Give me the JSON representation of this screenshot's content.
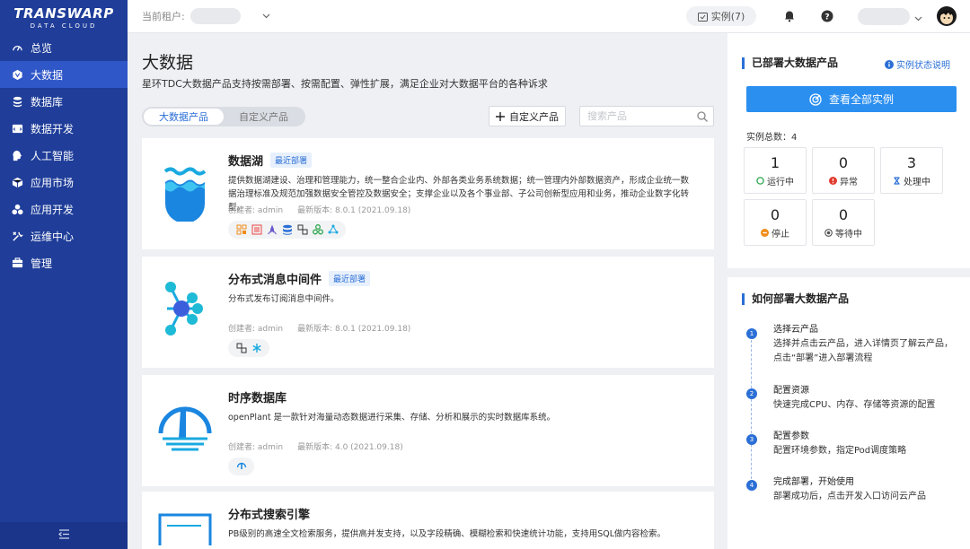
{
  "brand": {
    "line1": "TRANSWARP",
    "line2": "DATA CLOUD"
  },
  "sidebar": {
    "items": [
      {
        "label": "总览",
        "icon": "dashboard-icon"
      },
      {
        "label": "大数据",
        "icon": "bigdata-icon"
      },
      {
        "label": "数据库",
        "icon": "database-icon"
      },
      {
        "label": "数据开发",
        "icon": "dev-icon"
      },
      {
        "label": "人工智能",
        "icon": "ai-icon"
      },
      {
        "label": "应用市场",
        "icon": "market-icon"
      },
      {
        "label": "应用开发",
        "icon": "appdev-icon"
      },
      {
        "label": "运维中心",
        "icon": "ops-icon"
      },
      {
        "label": "管理",
        "icon": "admin-icon"
      }
    ],
    "active": "大数据"
  },
  "topbar": {
    "tenant_label": "当前租户:",
    "instances_label": "实例(7)"
  },
  "main": {
    "title": "大数据",
    "subtitle": "星环TDC大数据产品支持按需部署、按需配置、弹性扩展，满足企业对大数据平台的各种诉求",
    "tabs": [
      "大数据产品",
      "自定义产品"
    ],
    "custom_button": "自定义产品",
    "search_placeholder": "搜索产品",
    "products": [
      {
        "name": "数据湖",
        "badge": "最近部署",
        "desc": "提供数据湖建设、治理和管理能力，统一整合企业内、外部各类业务系统数据；统一管理内外部数据资产，形成企业统一数据治理标准及规范加强数据安全管控及数据安全；支撑企业以及各个事业部、子公司创新型应用和业务，推动企业数字化转型。",
        "creator": "创建者: admin",
        "version": "最新版本: 8.0.1 (2021.09.18)"
      },
      {
        "name": "分布式消息中间件",
        "badge": "最近部署",
        "desc": "分布式发布订阅消息中间件。",
        "creator": "创建者: admin",
        "version": "最新版本: 8.0.1 (2021.09.18)"
      },
      {
        "name": "时序数据库",
        "badge": "",
        "desc": "openPlant 是一款针对海量动态数据进行采集、存储、分析和展示的实时数据库系统。",
        "creator": "创建者: admin",
        "version": "最新版本: 4.0 (2021.09.18)"
      },
      {
        "name": "分布式搜索引擎",
        "badge": "",
        "desc": "PB级别的高速全文检索服务，提供高并发支持，以及字段精确、模糊检索和快速统计功能，支持用SQL做内容检索。",
        "creator": "",
        "version": ""
      }
    ]
  },
  "right": {
    "deployed_title": "已部署大数据产品",
    "help_link": "实例状态说明",
    "view_all": "查看全部实例",
    "total": "实例总数：4",
    "stats": [
      {
        "num": "1",
        "label": "运行中",
        "color": "#2fa84f"
      },
      {
        "num": "0",
        "label": "异常",
        "color": "#e23b2e"
      },
      {
        "num": "3",
        "label": "处理中",
        "color": "#2b6fd6"
      },
      {
        "num": "0",
        "label": "停止",
        "color": "#f08c1a"
      },
      {
        "num": "0",
        "label": "等待中",
        "color": "#555555"
      }
    ],
    "howto_title": "如何部署大数据产品",
    "steps": [
      {
        "n": "1",
        "title": "选择云产品",
        "desc": "选择并点击云产品，进入详情页了解云产品，点击“部署”进入部署流程"
      },
      {
        "n": "2",
        "title": "配置资源",
        "desc": "快速完成CPU、内存、存储等资源的配置"
      },
      {
        "n": "3",
        "title": "配置参数",
        "desc": "配置环境参数，指定Pod调度策略"
      },
      {
        "n": "4",
        "title": "完成部署，开始使用",
        "desc": "部署成功后，点击开发入口访问云产品"
      }
    ]
  }
}
